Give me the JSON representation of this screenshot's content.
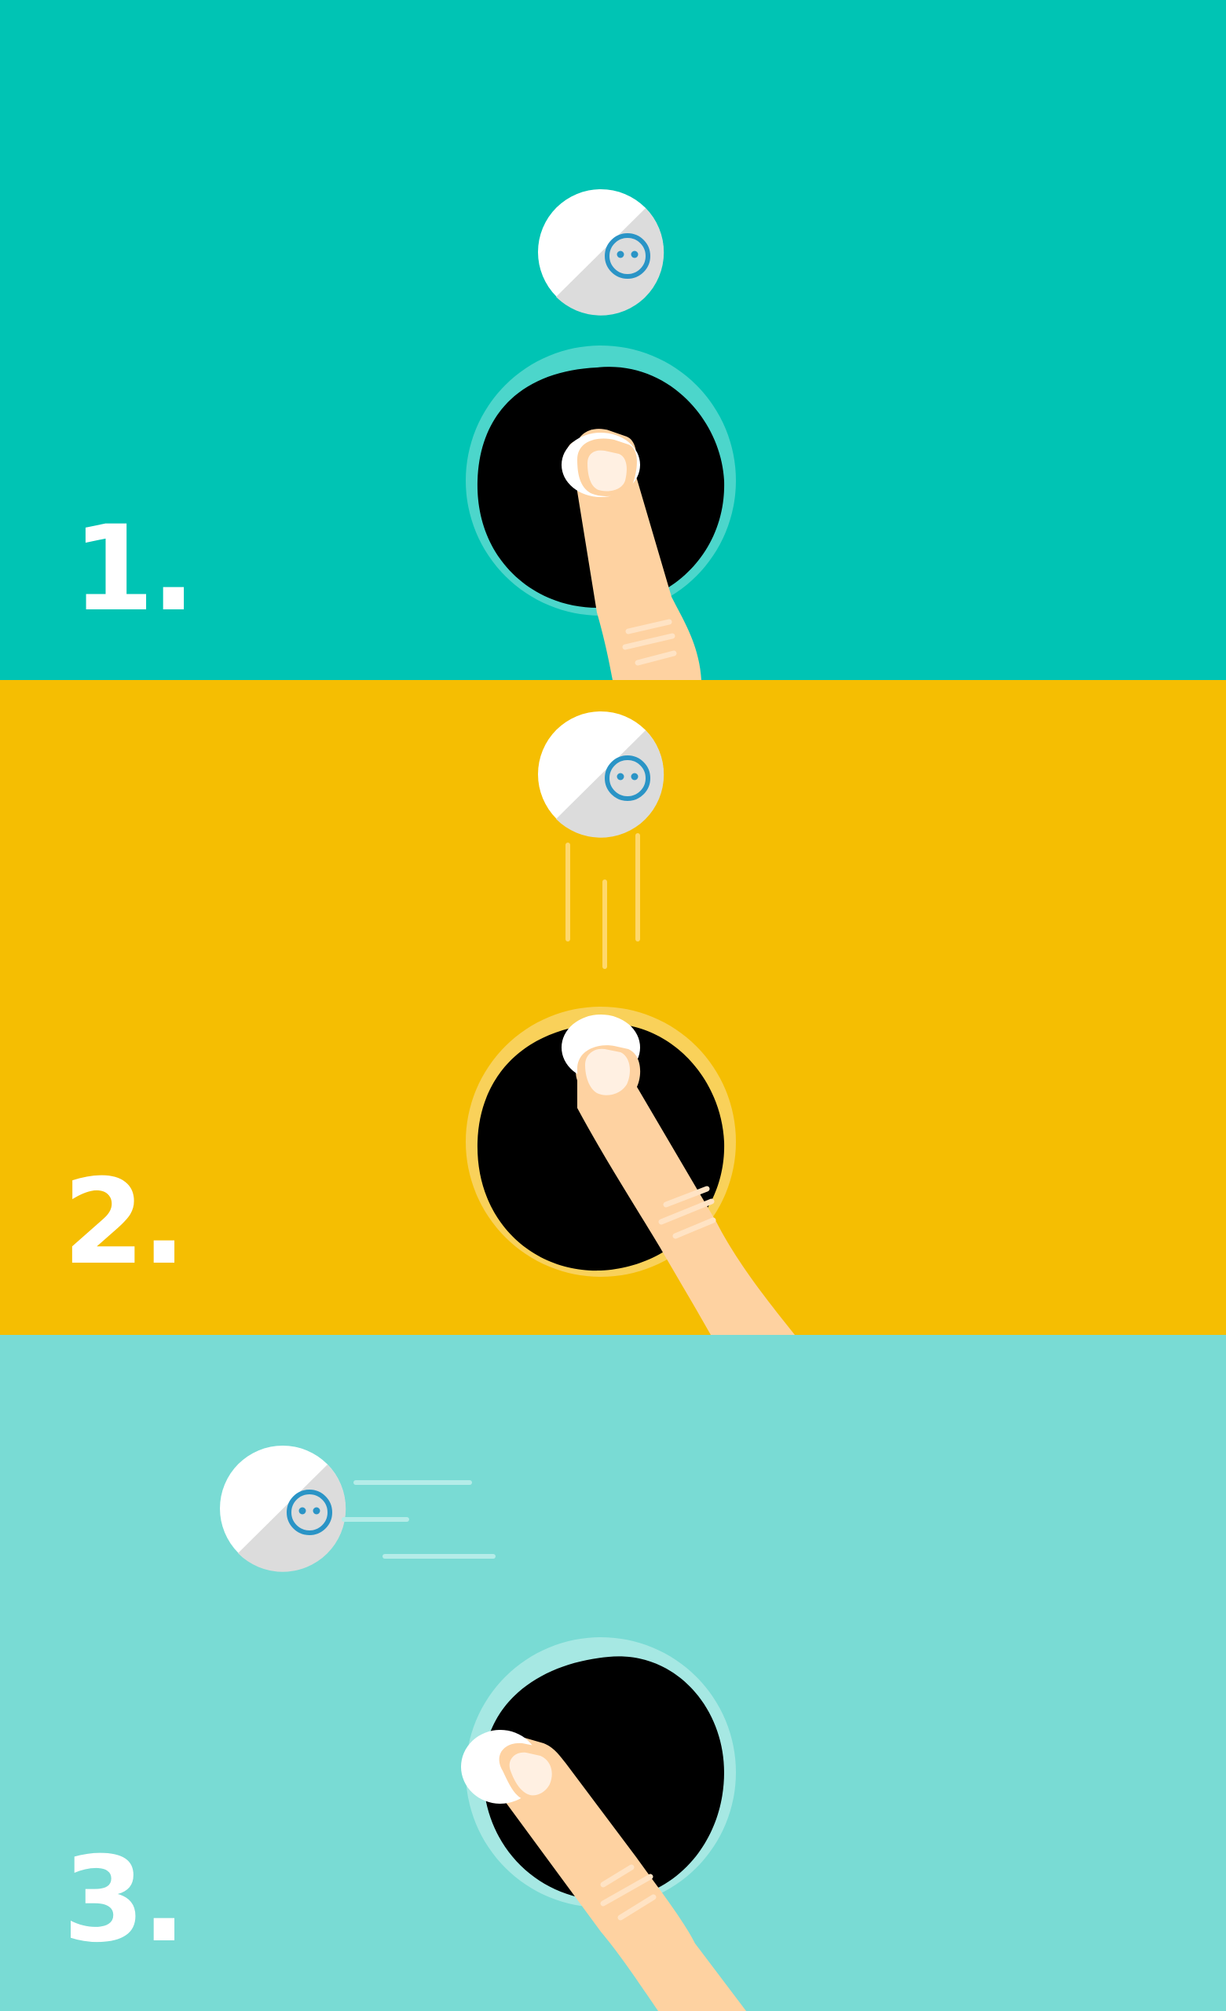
{
  "colors": {
    "panel_1_bg": "#00c4b4",
    "panel_2_bg": "#f5be02",
    "panel_3_bg": "#79dbd4",
    "hole": "#000000",
    "ball_white": "#ffffff",
    "ball_grey": "#dcdcdc",
    "ball_face": "#2a94c6",
    "finger_skin": "#fed2a1",
    "fingernail": "#fff0e2"
  },
  "steps": [
    {
      "number": "1.",
      "action": "press"
    },
    {
      "number": "2.",
      "action": "drop"
    },
    {
      "number": "3.",
      "action": "roll"
    }
  ]
}
